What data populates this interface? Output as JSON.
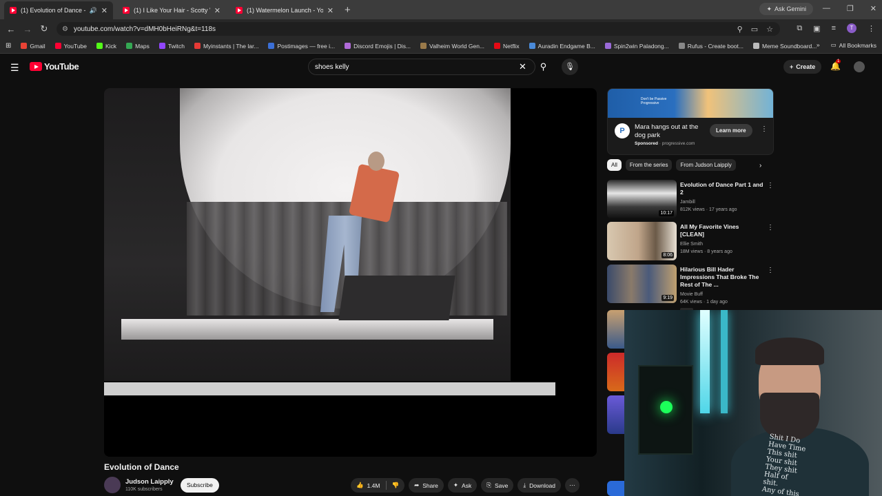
{
  "browser": {
    "tabs": [
      {
        "title": "(1) Evolution of Dance - Yo",
        "active": true,
        "audio": true
      },
      {
        "title": "(1) I Like Your Hair - Scotty Van",
        "active": false
      },
      {
        "title": "(1) Watermelon Launch - YouTu",
        "active": false
      }
    ],
    "gemini_label": "Ask Gemini",
    "url": "youtube.com/watch?v=dMH0bHeiRNg&t=118s",
    "bookmarks": [
      {
        "label": "Gmail",
        "color": "#ea4335"
      },
      {
        "label": "YouTube",
        "color": "#ff0033"
      },
      {
        "label": "Kick",
        "color": "#53fc18"
      },
      {
        "label": "Maps",
        "color": "#34a853"
      },
      {
        "label": "Twitch",
        "color": "#9146ff"
      },
      {
        "label": "Myinstants | The lar...",
        "color": "#e53935"
      },
      {
        "label": "Postimages — free i...",
        "color": "#3b6fd6"
      },
      {
        "label": "Discord Emojis | Dis...",
        "color": "#b06ad8"
      },
      {
        "label": "Valheim World Gen...",
        "color": "#9a7a4a"
      },
      {
        "label": "Netflix",
        "color": "#e50914"
      },
      {
        "label": "Auradin Endgame B...",
        "color": "#4a8ad8"
      },
      {
        "label": "Spin2win Paladong...",
        "color": "#9a6ad8"
      },
      {
        "label": "Rufus - Create boot...",
        "color": "#888888"
      },
      {
        "label": "Meme Soundboard...",
        "color": "#bbbbbb"
      }
    ],
    "all_bookmarks": "All Bookmarks"
  },
  "youtube": {
    "logo_text": "YouTube",
    "search_value": "shoes kelly",
    "create_label": "Create",
    "notif_count": "1"
  },
  "video": {
    "title": "Evolution of Dance",
    "channel": "Judson Laipply",
    "subscribers": "110K subscribers",
    "subscribe_label": "Subscribe",
    "likes": "1.4M",
    "share_label": "Share",
    "ask_label": "Ask",
    "save_label": "Save",
    "download_label": "Download"
  },
  "ad": {
    "banner_text": "Don't be Passive Progressive",
    "logo_letter": "P",
    "title": "Mara hangs out at the dog park",
    "sponsored": "Sponsored",
    "domain": "progressive.com",
    "learn_more": "Learn more"
  },
  "chips": [
    "All",
    "From the series",
    "From Judson Laipply"
  ],
  "recommendations": [
    {
      "title": "Evolution of Dance Part 1 and 2",
      "channel": "Jambill",
      "meta": "812K views · 17 years ago",
      "duration": "10:17"
    },
    {
      "title": "All My Favorite Vines [CLEAN]",
      "channel": "Ellie Smith",
      "meta": "18M views · 8 years ago",
      "duration": "8:06"
    },
    {
      "title": "Hilarious Bill Hader Impressions That Broke The Rest of The ...",
      "channel": "Movie Buff",
      "meta": "64K views · 1 day ago",
      "duration": "9:19",
      "badge": "New"
    }
  ],
  "webcam_shirt_text": "Shit I Do\nHave Time\nThis shit\nYour shit\nThey shit\nHalf of\nshit.\nAny of this"
}
